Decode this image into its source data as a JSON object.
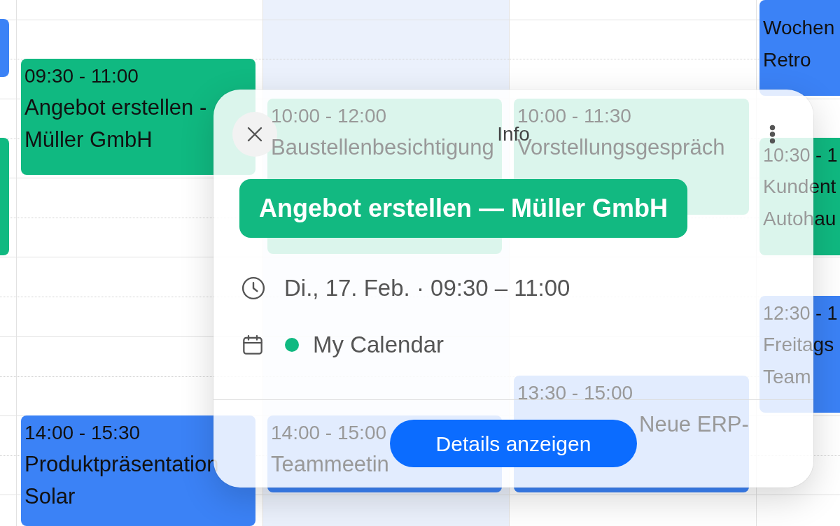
{
  "calendar": {
    "columns": [
      {
        "highlighted": false,
        "events": [
          {
            "color": "#3b82f6"
          },
          {
            "color": "#10b981"
          }
        ]
      },
      {
        "highlighted": false,
        "events": [
          {
            "time": "09:30 - 11:00",
            "title": "Angebot erstellen - Müller GmbH",
            "color": "#10b981"
          },
          {
            "time": "14:00 - 15:30",
            "title": "Produktpräsentation Solar",
            "color": "#3b82f6"
          }
        ]
      },
      {
        "highlighted": true,
        "events": [
          {
            "time": "10:00 - 12:00",
            "title": "Baustellenbesichtigung",
            "color": "#10b981"
          },
          {
            "time": "14:00 - 15:00",
            "title": "Teammeetin",
            "color": "#3b82f6"
          }
        ]
      },
      {
        "highlighted": false,
        "events": [
          {
            "time": "10:00 - 11:30",
            "title": "Vorstellungsgespräch",
            "color": "#10b981"
          },
          {
            "time": "13:30 - 15:00",
            "title": "Neue ERP-",
            "color": "#3b82f6"
          }
        ]
      },
      {
        "highlighted": false,
        "events": [
          {
            "title": "Wochen Retro",
            "color": "#3b82f6"
          },
          {
            "time": "10:30 - 1",
            "title": "Kundent Autohau",
            "color": "#10b981"
          },
          {
            "time": "12:30 - 1",
            "title": "Freitags Team",
            "color": "#3b82f6"
          }
        ]
      }
    ]
  },
  "popover": {
    "title": "Info",
    "event_title": "Angebot erstellen — Müller GmbH",
    "date_time": "Di., 17. Feb. · 09:30 – 11:00",
    "calendar_name": "My Calendar",
    "details_button": "Details anzeigen"
  }
}
